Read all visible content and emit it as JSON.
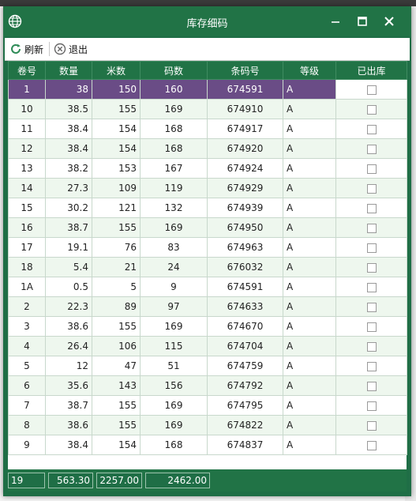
{
  "window": {
    "title": "库存细码",
    "accent": "#217346",
    "selected_color": "#6a4c86",
    "icons": {
      "app": "globe-icon",
      "minimize": "minimize-icon",
      "maximize": "maximize-icon",
      "close": "close-icon"
    }
  },
  "toolbar": {
    "refresh_label": "刷新",
    "refresh_icon": "refresh-icon",
    "exit_label": "退出",
    "exit_icon": "exit-circle-x-icon"
  },
  "grid": {
    "columns": [
      "卷号",
      "数量",
      "米数",
      "码数",
      "条码号",
      "等级",
      "已出库"
    ],
    "rows": [
      {
        "roll": "1",
        "qty": "38",
        "meters": "150",
        "yards": "160",
        "barcode": "674591",
        "grade": "A",
        "shipped": false
      },
      {
        "roll": "10",
        "qty": "38.5",
        "meters": "155",
        "yards": "169",
        "barcode": "674910",
        "grade": "A",
        "shipped": false
      },
      {
        "roll": "11",
        "qty": "38.4",
        "meters": "154",
        "yards": "168",
        "barcode": "674917",
        "grade": "A",
        "shipped": false
      },
      {
        "roll": "12",
        "qty": "38.4",
        "meters": "154",
        "yards": "168",
        "barcode": "674920",
        "grade": "A",
        "shipped": false
      },
      {
        "roll": "13",
        "qty": "38.2",
        "meters": "153",
        "yards": "167",
        "barcode": "674924",
        "grade": "A",
        "shipped": false
      },
      {
        "roll": "14",
        "qty": "27.3",
        "meters": "109",
        "yards": "119",
        "barcode": "674929",
        "grade": "A",
        "shipped": false
      },
      {
        "roll": "15",
        "qty": "30.2",
        "meters": "121",
        "yards": "132",
        "barcode": "674939",
        "grade": "A",
        "shipped": false
      },
      {
        "roll": "16",
        "qty": "38.7",
        "meters": "155",
        "yards": "169",
        "barcode": "674950",
        "grade": "A",
        "shipped": false
      },
      {
        "roll": "17",
        "qty": "19.1",
        "meters": "76",
        "yards": "83",
        "barcode": "674963",
        "grade": "A",
        "shipped": false
      },
      {
        "roll": "18",
        "qty": "5.4",
        "meters": "21",
        "yards": "24",
        "barcode": "676032",
        "grade": "A",
        "shipped": false
      },
      {
        "roll": "1A",
        "qty": "0.5",
        "meters": "5",
        "yards": "9",
        "barcode": "674591",
        "grade": "A",
        "shipped": false
      },
      {
        "roll": "2",
        "qty": "22.3",
        "meters": "89",
        "yards": "97",
        "barcode": "674633",
        "grade": "A",
        "shipped": false
      },
      {
        "roll": "3",
        "qty": "38.6",
        "meters": "155",
        "yards": "169",
        "barcode": "674670",
        "grade": "A",
        "shipped": false
      },
      {
        "roll": "4",
        "qty": "26.4",
        "meters": "106",
        "yards": "115",
        "barcode": "674704",
        "grade": "A",
        "shipped": false
      },
      {
        "roll": "5",
        "qty": "12",
        "meters": "47",
        "yards": "51",
        "barcode": "674759",
        "grade": "A",
        "shipped": false
      },
      {
        "roll": "6",
        "qty": "35.6",
        "meters": "143",
        "yards": "156",
        "barcode": "674792",
        "grade": "A",
        "shipped": false
      },
      {
        "roll": "7",
        "qty": "38.7",
        "meters": "155",
        "yards": "169",
        "barcode": "674795",
        "grade": "A",
        "shipped": false
      },
      {
        "roll": "8",
        "qty": "38.6",
        "meters": "155",
        "yards": "169",
        "barcode": "674822",
        "grade": "A",
        "shipped": false
      },
      {
        "roll": "9",
        "qty": "38.4",
        "meters": "154",
        "yards": "168",
        "barcode": "674837",
        "grade": "A",
        "shipped": false
      }
    ],
    "selected_row": 0
  },
  "footer": {
    "count": "19",
    "qty_total": "563.30",
    "meters_total": "2257.00",
    "yards_total": "2462.00"
  }
}
